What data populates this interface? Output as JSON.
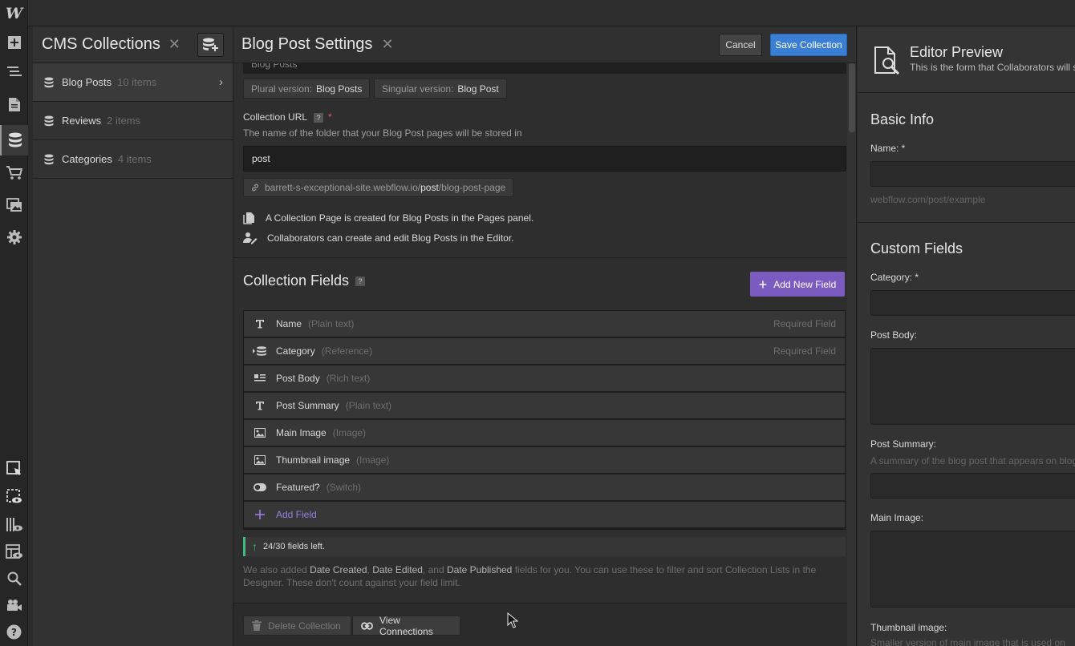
{
  "app": {
    "logo": "W"
  },
  "collections_panel": {
    "title": "CMS Collections",
    "items": [
      {
        "name": "Blog Posts",
        "count": "10 items"
      },
      {
        "name": "Reviews",
        "count": "2 items"
      },
      {
        "name": "Categories",
        "count": "4 items"
      }
    ]
  },
  "settings": {
    "title": "Blog Post Settings",
    "cancel_label": "Cancel",
    "save_label": "Save Collection",
    "collection_name_value": "Blog Posts",
    "plural_label": "Plural version:",
    "plural_value": "Blog Posts",
    "singular_label": "Singular version:",
    "singular_value": "Blog Post",
    "url_label": "Collection URL",
    "help_mark": "?",
    "required_mark": "*",
    "url_hint": "The name of the folder that your Blog Post pages will be stored in",
    "url_value": "post",
    "url_preview_prefix": "barrett-s-exceptional-site.webflow.io/",
    "url_preview_slug": "post",
    "url_preview_suffix": "/blog-post-page",
    "info_pages": "A Collection Page is created for Blog Posts in the Pages panel.",
    "info_editor": "Collaborators can create and edit Blog Posts in the Editor.",
    "fields_title": "Collection Fields",
    "add_new_field_label": "Add New Field",
    "fields": [
      {
        "name": "Name",
        "type": "(Plain text)",
        "required": "Required Field",
        "icon": "text-icon"
      },
      {
        "name": "Category",
        "type": "(Reference)",
        "required": "Required Field",
        "icon": "reference-icon"
      },
      {
        "name": "Post Body",
        "type": "(Rich text)",
        "required": "",
        "icon": "rich-text-icon"
      },
      {
        "name": "Post Summary",
        "type": "(Plain text)",
        "required": "",
        "icon": "text-icon"
      },
      {
        "name": "Main Image",
        "type": "(Image)",
        "required": "",
        "icon": "image-icon"
      },
      {
        "name": "Thumbnail image",
        "type": "(Image)",
        "required": "",
        "icon": "image-icon"
      },
      {
        "name": "Featured?",
        "type": "(Switch)",
        "required": "",
        "icon": "switch-icon"
      }
    ],
    "add_field_label": "Add Field",
    "fields_left": "24/30 fields left.",
    "note_part1": "We also added ",
    "note_date_created": "Date Created",
    "note_sep1": ", ",
    "note_date_edited": "Date Edited",
    "note_sep2": ", and ",
    "note_date_published": "Date Published",
    "note_part2": " fields for you. You can use these to filter and sort Collection Lists in the Designer. These don't count against your field limit.",
    "delete_label": "Delete Collection",
    "view_connections_label": "View Connections"
  },
  "preview": {
    "title": "Editor Preview",
    "subtitle": "This is the form that Collaborators will see",
    "basic_info": "Basic Info",
    "name_label": "Name: *",
    "name_hint": "webflow.com/post/example",
    "custom_fields": "Custom Fields",
    "category_label": "Category: *",
    "post_body_label": "Post Body:",
    "post_summary_label": "Post Summary:",
    "post_summary_hint": "A summary of the blog post that appears on blog",
    "main_image_label": "Main Image:",
    "thumbnail_label": "Thumbnail image:",
    "thumbnail_hint": "Smaller version of main image that is used on"
  },
  "colors": {
    "accent_blue": "#3b7fd4",
    "accent_purple": "#7b5bbf",
    "success_green": "#3dba7e",
    "required_red": "#e25c5c"
  }
}
